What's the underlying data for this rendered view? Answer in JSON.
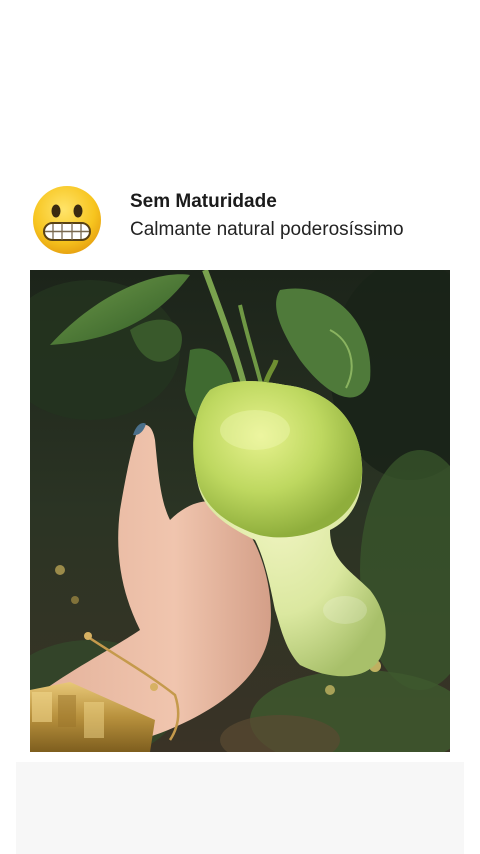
{
  "post": {
    "author_name": "Sem Maturidade",
    "caption": "Calmante natural poderosíssimo",
    "avatar_icon": "grimacing-face-emoji-icon"
  },
  "photo": {
    "subject": "guava-fruit-held-in-hand-photo"
  },
  "colors": {
    "background": "#ffffff",
    "name_text": "#1b1b1b",
    "caption_text": "#232323",
    "emoji_yellow": "#f6c21d"
  }
}
